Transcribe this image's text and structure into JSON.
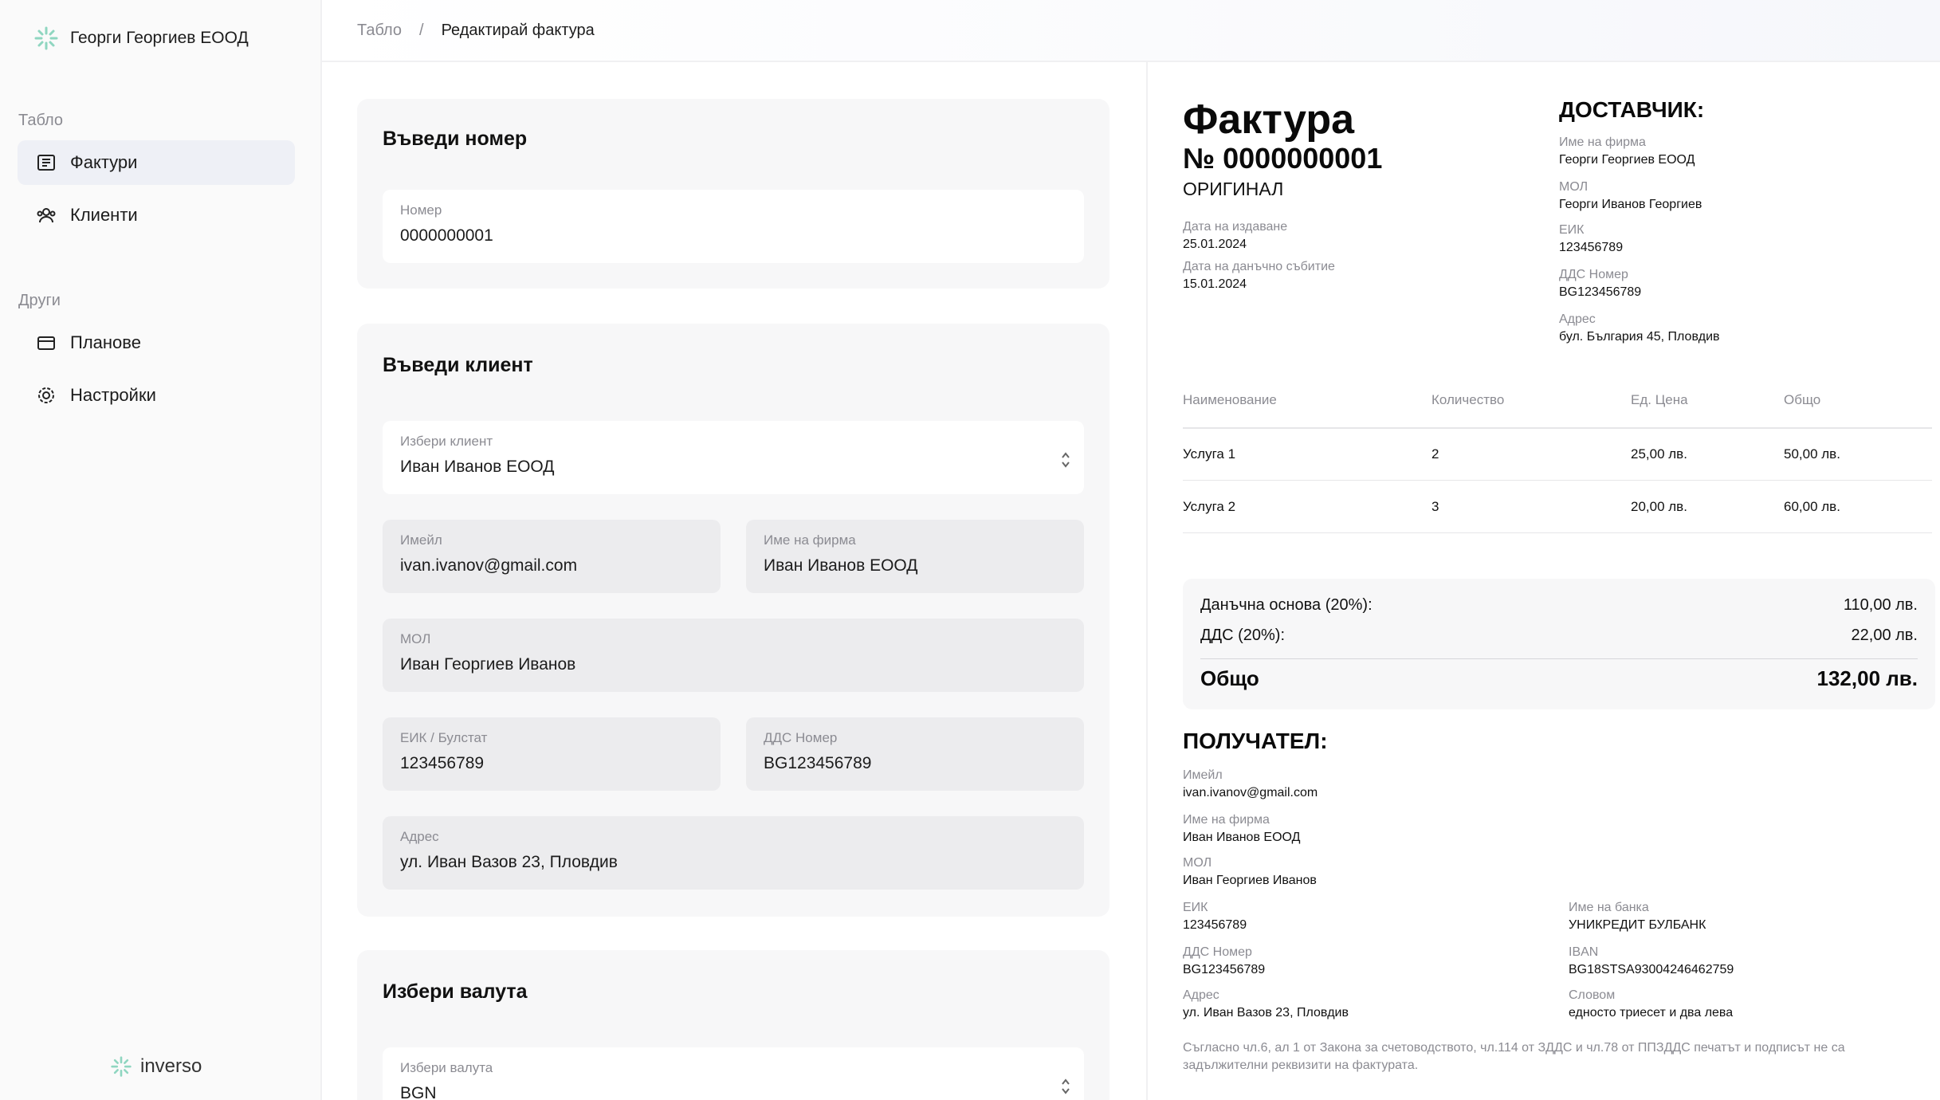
{
  "sidebar": {
    "company": "Георги Георгиев ЕООД",
    "section_main": "Табло",
    "section_other": "Други",
    "items": [
      {
        "label": "Фактури",
        "icon": "invoice-icon"
      },
      {
        "label": "Клиенти",
        "icon": "users-icon"
      },
      {
        "label": "Планове",
        "icon": "wallet-icon"
      },
      {
        "label": "Настройки",
        "icon": "gear-icon"
      }
    ],
    "footer_brand": "inverso"
  },
  "breadcrumb": {
    "root": "Табло",
    "separator": "/",
    "current": "Редактирай фактура"
  },
  "form": {
    "number_card": {
      "title": "Въведи номер",
      "label": "Номер",
      "value": "0000000001"
    },
    "client_card": {
      "title": "Въведи клиент",
      "select_label": "Избери клиент",
      "select_value": "Иван Иванов ЕООД",
      "email_label": "Имейл",
      "email_value": "ivan.ivanov@gmail.com",
      "company_label": "Име на фирма",
      "company_value": "Иван Иванов ЕООД",
      "mol_label": "МОЛ",
      "mol_value": "Иван Георгиев Иванов",
      "eik_label": "ЕИК / Булстат",
      "eik_value": "123456789",
      "vat_label": "ДДС Номер",
      "vat_value": "BG123456789",
      "address_label": "Адрес",
      "address_value": "ул. Иван Вазов 23, Пловдив"
    },
    "currency_card": {
      "title": "Избери валута",
      "label": "Избери валута",
      "value": "BGN"
    }
  },
  "invoice": {
    "title": "Фактура",
    "number": "№ 0000000001",
    "copy": "ОРИГИНАЛ",
    "issue_label": "Дата на издаване",
    "issue_date": "25.01.2024",
    "tax_event_label": "Дата на данъчно събитие",
    "tax_event_date": "15.01.2024",
    "supplier": {
      "heading": "ДОСТАВЧИК:",
      "company_label": "Име на фирма",
      "company": "Георги Георгиев ЕООД",
      "mol_label": "МОЛ",
      "mol": "Георги Иванов Георгиев",
      "eik_label": "ЕИК",
      "eik": "123456789",
      "vat_label": "ДДС Номер",
      "vat": "BG123456789",
      "address_label": "Адрес",
      "address": "бул. България 45, Пловдив"
    },
    "table": {
      "headers": [
        "Наименование",
        "Количество",
        "Ед. Цена",
        "Общо"
      ],
      "rows": [
        [
          "Услуга 1",
          "2",
          "25,00 лв.",
          "50,00 лв."
        ],
        [
          "Услуга 2",
          "3",
          "20,00 лв.",
          "60,00 лв."
        ]
      ]
    },
    "totals": {
      "base_label": "Данъчна основа (20%):",
      "base": "110,00 лв.",
      "vat_label": "ДДС (20%):",
      "vat": "22,00 лв.",
      "total_label": "Общо",
      "total": "132,00 лв."
    },
    "recipient": {
      "heading": "ПОЛУЧАТЕЛ:",
      "email_label": "Имейл",
      "email": "ivan.ivanov@gmail.com",
      "company_label": "Име на фирма",
      "company": "Иван Иванов ЕООД",
      "mol_label": "МОЛ",
      "mol": "Иван Георгиев Иванов",
      "eik_label": "ЕИК",
      "eik": "123456789",
      "vat_label": "ДДС Номер",
      "vat": "BG123456789",
      "address_label": "Адрес",
      "address": "ул. Иван Вазов 23, Пловдив",
      "bank_label": "Име на банка",
      "bank": "УНИКРЕДИТ БУЛБАНК",
      "iban_label": "IBAN",
      "iban": "BG18STSA93004246462759",
      "words_label": "Словом",
      "words": "едносто триесет и два лева"
    },
    "note": "Съгласно чл.6, ал 1 от Закона за счетоводството, чл.114 от ЗДДС и чл.78 от ППЗДДС печатът и подписът не са задължителни реквизити на фактурата."
  },
  "colors": {
    "accent_logo": "#7fd0b8",
    "active_nav": "#eef0f6",
    "field_bg": "#ececee",
    "card_bg": "#f7f7f8"
  }
}
